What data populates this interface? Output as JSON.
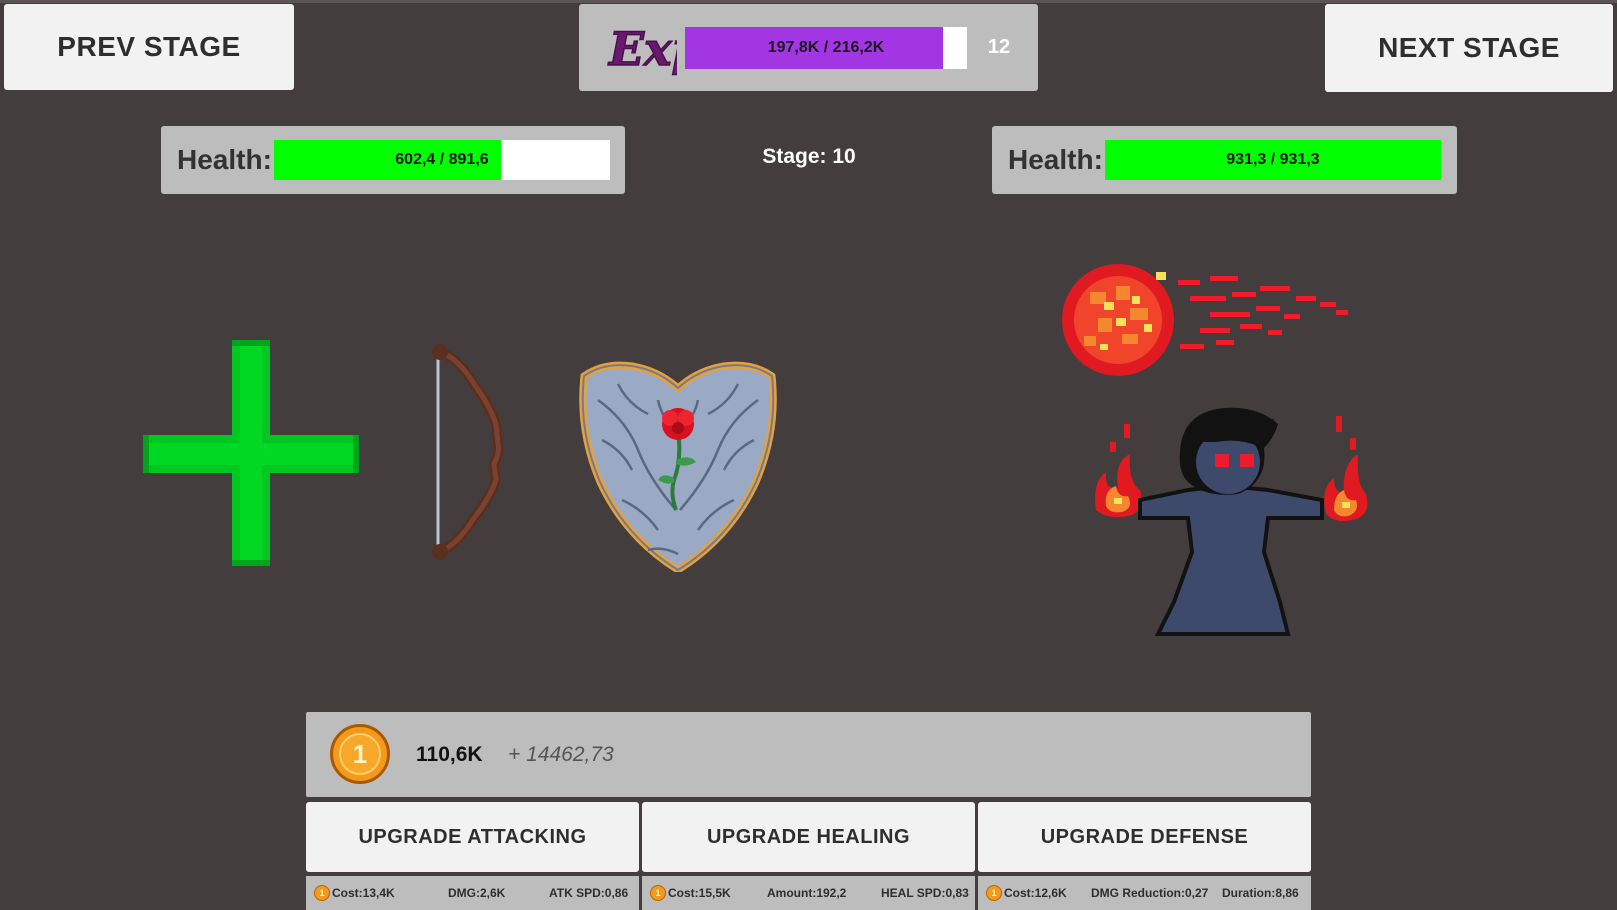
{
  "nav": {
    "prev_label": "PREV STAGE",
    "next_label": "NEXT STAGE"
  },
  "exp": {
    "logo_text": "Exp",
    "text": "197,8K / 216,2K",
    "current": 197.8,
    "max": 216.2,
    "level": "12",
    "bar_color": "#a336e3"
  },
  "stage": {
    "label": "Stage: 10"
  },
  "player": {
    "health_label": "Health:",
    "health_text": "602,4 / 891,6",
    "current": 602.4,
    "max": 891.6,
    "equipment": [
      "health-cross",
      "bow",
      "rose-shield"
    ]
  },
  "enemy": {
    "health_label": "Health:",
    "health_text": "931,3 / 931,3",
    "current": 931.3,
    "max": 931.3,
    "sprites": [
      "fireball",
      "dark-mage"
    ]
  },
  "currency": {
    "coin_symbol": "1",
    "amount": "110,6K",
    "income": "+ 14462,73"
  },
  "upgrades": [
    {
      "label": "UPGRADE ATTACKING",
      "coin": "1",
      "stats": [
        "Cost:13,4K",
        "DMG:2,6K",
        "ATK SPD:0,86"
      ]
    },
    {
      "label": "UPGRADE HEALING",
      "coin": "1",
      "stats": [
        "Cost:15,5K",
        "Amount:192,2",
        "HEAL SPD:0,83"
      ]
    },
    {
      "label": "UPGRADE DEFENSE",
      "coin": "1",
      "stats": [
        "Cost:12,6K",
        "DMG Reduction:0,27",
        "Duration:8,86"
      ]
    }
  ],
  "colors": {
    "background": "#433e3d",
    "health": "#00ff00",
    "exp": "#a336e3",
    "coin": "#f39a1c"
  }
}
